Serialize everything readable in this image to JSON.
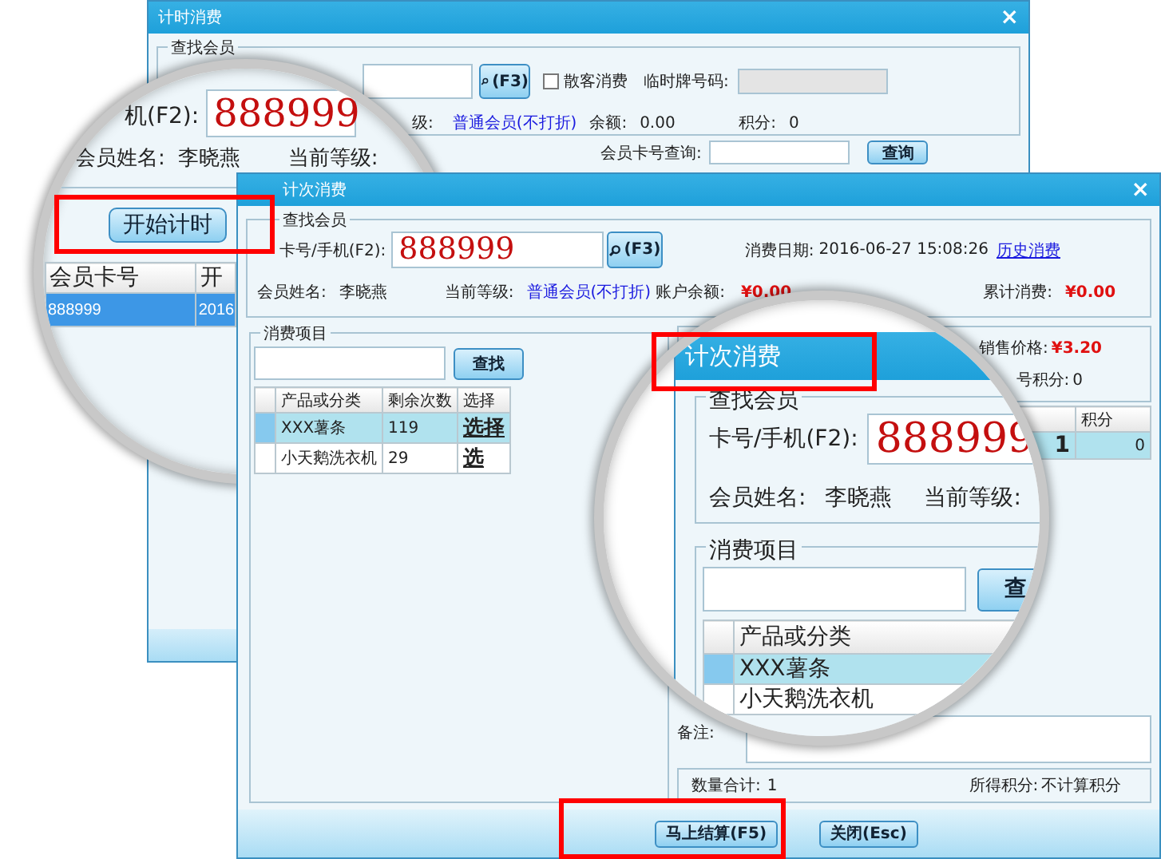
{
  "timer_window": {
    "title": "计时消费",
    "close": "×",
    "member_group": {
      "legend": "查找会员",
      "search_button": "(F3)",
      "walk_in": {
        "label": "散客消费",
        "checked": false
      },
      "temp_number_label": "临时牌号码:",
      "level_label": "级:",
      "level": "普通会员(不打折)",
      "balance_label": "余额:",
      "balance": "0.00",
      "points_label": "积分:",
      "points": "0"
    },
    "card_query_label": "会员卡号查询:",
    "query_button": "查询"
  },
  "timer_magnifier": {
    "card_label": "机(F2):",
    "card_value": "888999",
    "name_label": "会员姓名:",
    "name": "李晓燕",
    "level_label": "当前等级:",
    "start_button": "开始计时",
    "highlighted": true,
    "columns": [
      "会员卡号",
      "开"
    ],
    "rows": [
      {
        "cells": [
          "888999",
          "2016"
        ],
        "selected": true
      }
    ]
  },
  "count_window": {
    "title": "计次消费",
    "close": "×",
    "member_group": {
      "legend": "查找会员",
      "card_label": "卡号/手机(F2):",
      "card_value": "888999",
      "search_button": "(F3)",
      "date_label": "消费日期:",
      "date": "2016-06-27 15:08:26",
      "history_link": "历史消费",
      "name_label": "会员姓名:",
      "name": "李晓燕",
      "level_label": "当前等级:",
      "level": "普通会员(不打折)",
      "balance_label": "账户余额:",
      "balance": "¥0.00",
      "total_label": "累计消费:",
      "total": "¥0.00"
    },
    "items_group": {
      "legend": "消费项目",
      "find_button": "查找",
      "columns": [
        "产品或分类",
        "剩余次数",
        "选择"
      ],
      "rows": [
        {
          "cells": [
            "XXX薯条",
            "119",
            "选择"
          ],
          "selected": true
        },
        {
          "cells": [
            "小天鹅洗衣机",
            "29",
            "选"
          ],
          "selected": false
        }
      ]
    },
    "detail": {
      "price_label": "销售价格:",
      "price": "¥3.20",
      "points_label": "号积分:",
      "points": "0",
      "column_header": "积分",
      "row": [
        "1",
        "0"
      ],
      "remark_label": "备注:",
      "quantity_label": "数量合计:",
      "quantity": "1",
      "earned_label": "所得积分:",
      "earned": "不计算积分"
    },
    "buttons": [
      {
        "label": "马上结算(F5)",
        "highlighted": true
      },
      {
        "label": "关闭(Esc)",
        "highlighted": false
      }
    ]
  },
  "count_magnifier": {
    "title": "计次消费",
    "title_highlighted": true,
    "member_legend": "查找会员",
    "card_label": "卡号/手机(F2):",
    "card_value": "888999",
    "name_label": "会员姓名:",
    "name": "李晓燕",
    "level_label": "当前等级:",
    "items_legend": "消费项目",
    "find_button": "查",
    "columns": [
      "产品或分类"
    ],
    "rows": [
      {
        "cells": [
          "XXX薯条"
        ],
        "selected": true
      },
      {
        "cells": [
          "小天鹅洗衣机"
        ],
        "selected": false
      }
    ]
  }
}
